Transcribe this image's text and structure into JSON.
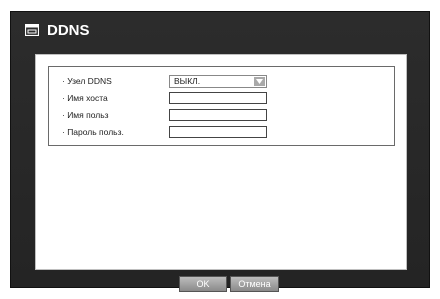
{
  "window": {
    "title": "DDNS",
    "title_icon": "window-icon"
  },
  "form": {
    "rows": [
      {
        "label": "· Узел DDNS",
        "value": "ВЫКЛ.",
        "type": "select"
      },
      {
        "label": "· Имя хоста",
        "value": "",
        "type": "text"
      },
      {
        "label": "· Имя польз",
        "value": "",
        "type": "text"
      },
      {
        "label": "· Пароль польз.",
        "value": "",
        "type": "text"
      }
    ]
  },
  "buttons": {
    "ok": "OK",
    "cancel": "Отмена"
  },
  "colors": {
    "frame": "#2a2a2a",
    "panel": "#ffffff",
    "button": "#a6a6a6"
  }
}
